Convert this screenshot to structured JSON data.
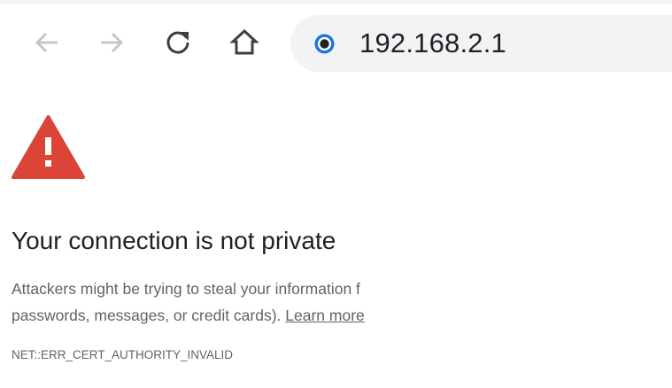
{
  "browser": {
    "nav": {
      "back_icon": "arrow-left-icon",
      "forward_icon": "arrow-right-icon",
      "reload_icon": "reload-icon",
      "home_icon": "home-icon"
    },
    "address_bar": {
      "url": "192.168.2.1",
      "site_icon": "info-dot-icon"
    }
  },
  "interstitial": {
    "icon": "warning-triangle-icon",
    "heading": "Your connection is not private",
    "body_line1": "Attackers might be trying to steal your information f",
    "body_line2_prefix": "passwords, messages, or credit cards). ",
    "learn_more": "Learn more",
    "error_code": "NET::ERR_CERT_AUTHORITY_INVALID"
  },
  "colors": {
    "warning_red": "#db4437",
    "site_icon_blue": "#1a73e8",
    "toolbar_gray": "#f1f3f4",
    "text_primary": "#202124",
    "text_secondary": "#5f6368"
  }
}
